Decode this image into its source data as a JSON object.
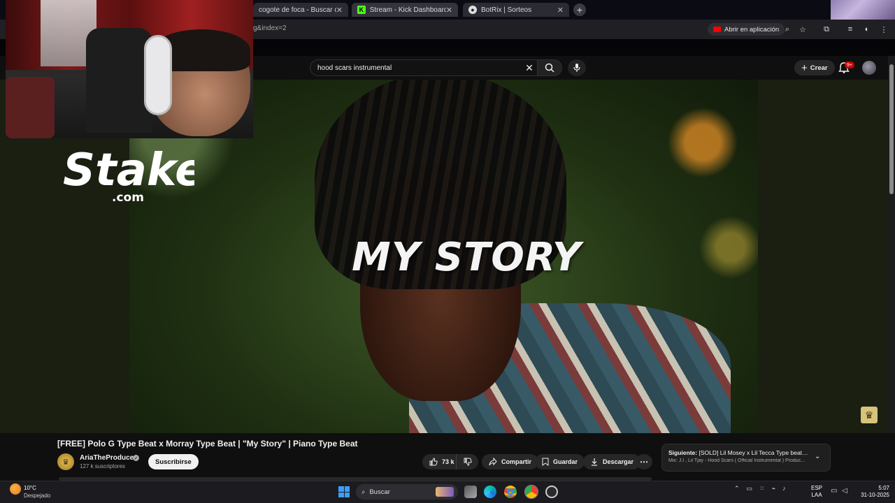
{
  "browser": {
    "tabs": [
      {
        "title": "cogote de foca - Buscar con G",
        "icon": "google-icon"
      },
      {
        "title": "Stream - Kick Dashboard",
        "icon": "kick-icon"
      },
      {
        "title": "BotRix | Sorteos",
        "icon": "botrix-icon"
      }
    ],
    "url": "g&index=2",
    "open_app_label": "Abrir en aplicación"
  },
  "youtube": {
    "search_query": "hood scars instrumental",
    "create_label": "Crear",
    "notifications_badge": "9+"
  },
  "video": {
    "overlay_title": "MY STORY",
    "title": "[FREE] Polo G Type Beat x Morray Type Beat | \"My Story\" | Piano Type Beat",
    "channel": "AriaTheProducer",
    "subscribers": "127 k suscriptores",
    "subscribe_label": "Suscribirse",
    "likes": "73 k",
    "share_label": "Compartir",
    "save_label": "Guardar",
    "download_label": "Descargar"
  },
  "up_next": {
    "label": "Siguiente:",
    "title": "[SOLD] Lil Mosey x Lil Tecca Type beat \"I...",
    "subtitle": "Mix: J.I , Lil Tjay - Hood Scars ( Official Instrumental ) Produc..."
  },
  "overlay": {
    "sponsor_main": "Stake",
    "sponsor_sub": ".com"
  },
  "taskbar": {
    "weather_temp": "10°C",
    "weather_desc": "Despejado",
    "search_label": "Buscar",
    "lang_line1": "ESP",
    "lang_line2": "LAA",
    "time": "5:07",
    "date": "31-10-2025"
  },
  "colors": {
    "youtube_red": "#ff0000",
    "kick_green": "#53fc18",
    "windows_blue": "#3aa0ff"
  }
}
